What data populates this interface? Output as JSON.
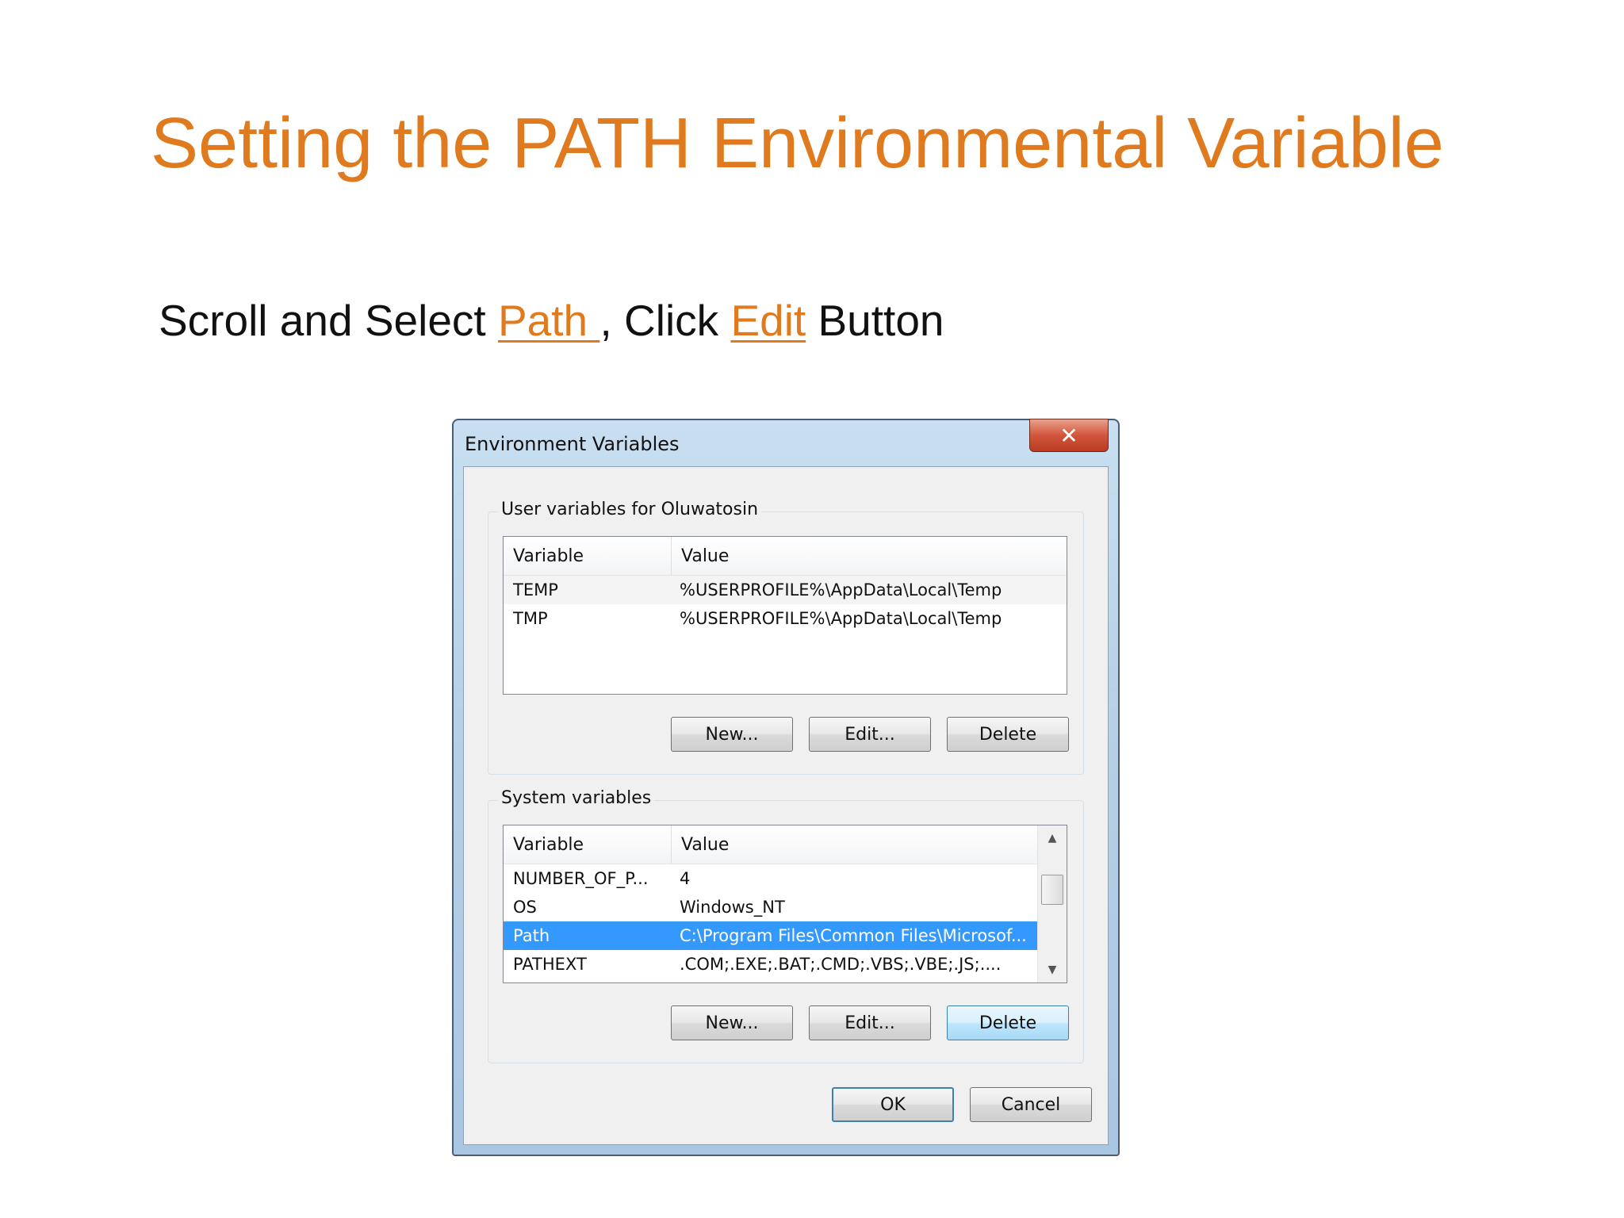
{
  "slide": {
    "title": "Setting the PATH Environmental Variable",
    "instruction": {
      "prefix": "Scroll and Select ",
      "highlight1": "Path ",
      "middle": ", Click ",
      "highlight2": "Edit",
      "suffix": " Button"
    }
  },
  "dialog": {
    "title": "Environment Variables",
    "close_label": "✕",
    "user_group": {
      "label": "User variables for Oluwatosin",
      "columns": [
        "Variable",
        "Value"
      ],
      "rows": [
        {
          "variable": "TEMP",
          "value": "%USERPROFILE%\\AppData\\Local\\Temp"
        },
        {
          "variable": "TMP",
          "value": "%USERPROFILE%\\AppData\\Local\\Temp"
        }
      ],
      "buttons": {
        "new": "New...",
        "edit": "Edit...",
        "delete": "Delete"
      }
    },
    "system_group": {
      "label": "System variables",
      "columns": [
        "Variable",
        "Value"
      ],
      "rows": [
        {
          "variable": "NUMBER_OF_P...",
          "value": "4"
        },
        {
          "variable": "OS",
          "value": "Windows_NT"
        },
        {
          "variable": "Path",
          "value": "C:\\Program Files\\Common Files\\Microsof..."
        },
        {
          "variable": "PATHEXT",
          "value": ".COM;.EXE;.BAT;.CMD;.VBS;.VBE;.JS;...."
        }
      ],
      "selected_index": 2,
      "buttons": {
        "new": "New...",
        "edit": "Edit...",
        "delete": "Delete"
      }
    },
    "ok_label": "OK",
    "cancel_label": "Cancel"
  },
  "colors": {
    "accent": "#e07a1f",
    "selection": "#3399ff"
  }
}
